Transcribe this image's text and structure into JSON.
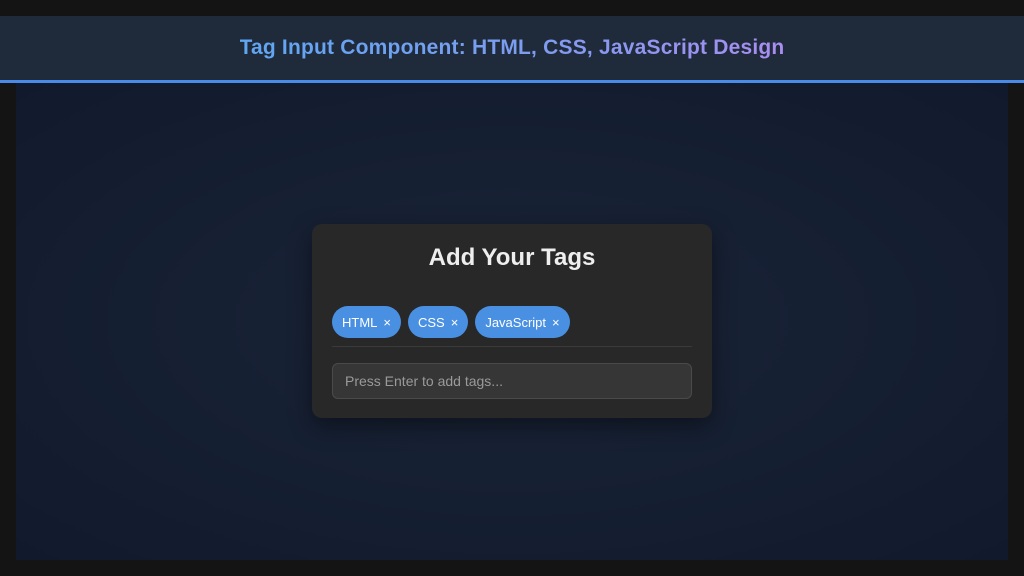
{
  "header": {
    "title": "Tag Input Component: HTML, CSS, JavaScript Design"
  },
  "card": {
    "title": "Add Your Tags",
    "tags": [
      {
        "label": "HTML",
        "remove": "×"
      },
      {
        "label": "CSS",
        "remove": "×"
      },
      {
        "label": "JavaScript",
        "remove": "×"
      }
    ],
    "input": {
      "placeholder": "Press Enter to add tags...",
      "value": ""
    }
  },
  "colors": {
    "accent": "#4a90e2",
    "header_bg": "#1f2a3b",
    "card_bg": "#282828"
  }
}
